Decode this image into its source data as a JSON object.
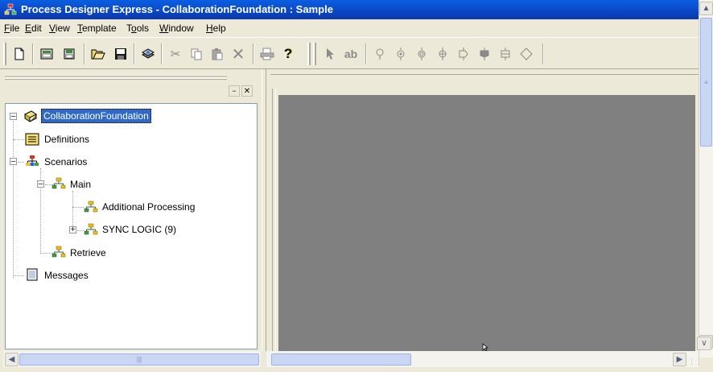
{
  "window": {
    "title": "Process Designer Express - CollaborationFoundation : Sample"
  },
  "menubar": [
    {
      "label": "File",
      "key": "F",
      "rest": "ile"
    },
    {
      "label": "Edit",
      "key": "E",
      "rest": "dit"
    },
    {
      "label": "View",
      "key": "V",
      "rest": "iew"
    },
    {
      "label": "Template",
      "key": "T",
      "rest": "emplate"
    },
    {
      "label": "Tools",
      "pre": "T",
      "key": "o",
      "rest": "ols"
    },
    {
      "label": "Window",
      "key": "W",
      "rest": "indow"
    },
    {
      "label": "Help",
      "key": "H",
      "rest": "elp"
    }
  ],
  "toolbar": {
    "buttons": [
      "new-icon",
      "open-template-icon",
      "save-template-icon",
      "open-icon",
      "save-icon",
      "deploy-icon",
      "cut-icon",
      "copy-icon",
      "paste-icon",
      "delete-icon",
      "print-icon",
      "help-icon",
      "pointer-icon",
      "text-tool-icon",
      "start-node-icon",
      "action-node-icon",
      "decision-node-icon",
      "sync-node-icon",
      "iterator-node-icon",
      "subdiagram-node-icon",
      "end-node-icon",
      "connector-icon"
    ],
    "text_tool_label": "ab"
  },
  "tree": {
    "root": {
      "label": "CollaborationFoundation"
    },
    "definitions": {
      "label": "Definitions"
    },
    "scenarios": {
      "label": "Scenarios"
    },
    "main": {
      "label": "Main"
    },
    "additional": {
      "label": "Additional Processing"
    },
    "sync": {
      "label": "SYNC LOGIC (9)"
    },
    "retrieve": {
      "label": "Retrieve"
    },
    "messages": {
      "label": "Messages"
    }
  },
  "colors": {
    "titlebar": "#0a46c4",
    "canvas": "#808080",
    "selection": "#316ac5"
  }
}
